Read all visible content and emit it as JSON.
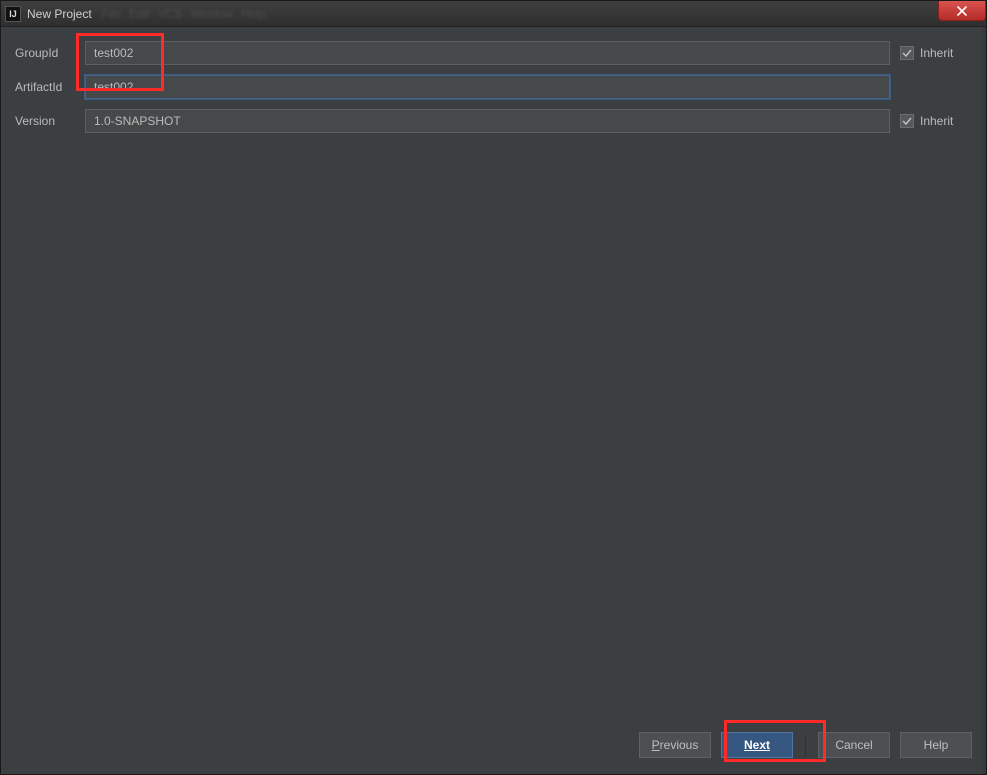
{
  "window": {
    "title": "New Project",
    "blurred_menu": [
      "File",
      "Edit",
      "VCS",
      "Window",
      "Help"
    ]
  },
  "form": {
    "groupId": {
      "label": "GroupId",
      "value": "test002",
      "inherit_label": "Inherit",
      "inherit_checked": true
    },
    "artifactId": {
      "label": "ArtifactId",
      "value": "test002"
    },
    "version": {
      "label": "Version",
      "value": "1.0-SNAPSHOT",
      "inherit_label": "Inherit",
      "inherit_checked": true
    }
  },
  "buttons": {
    "previous": "Previous",
    "next": "Next",
    "cancel": "Cancel",
    "help": "Help"
  }
}
